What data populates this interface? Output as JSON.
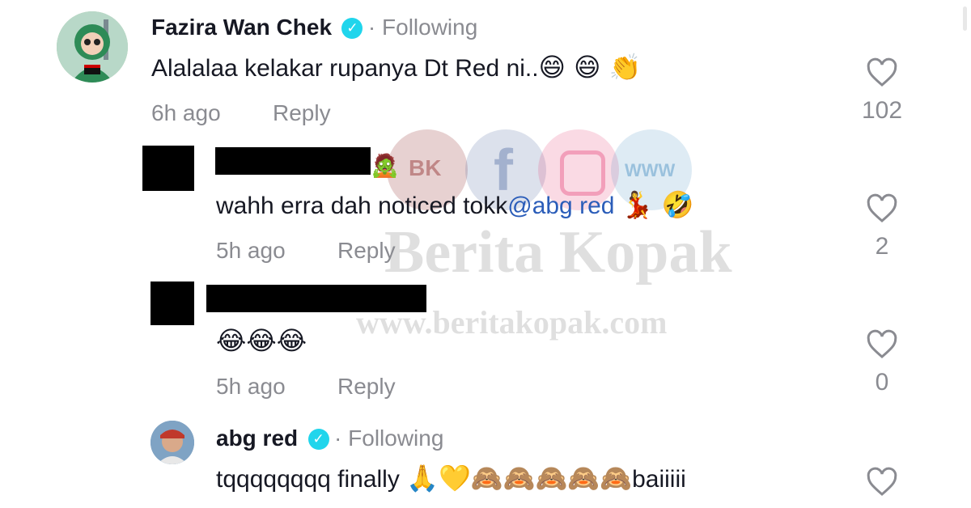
{
  "comments": [
    {
      "author": "Fazira Wan Chek",
      "verified_icon": "verified-check-icon",
      "following": "· Following",
      "text": "Alalalaa kelakar rupanya Dt Red ni..",
      "emojis": "😄 😄 👏",
      "time": "6h ago",
      "reply": "Reply",
      "likes": "102"
    },
    {
      "author": "",
      "author_emoji": "🧟",
      "text_before": "wahh erra dah noticed tokk",
      "mention": "@abg red",
      "emojis": "💃 🤣",
      "time": "5h ago",
      "reply": "Reply",
      "likes": "2"
    },
    {
      "author": "",
      "emojis": "😂😂😂",
      "time": "5h ago",
      "reply": "Reply",
      "likes": "0"
    },
    {
      "author": "abg red",
      "verified_icon": "verified-check-icon",
      "following": "· Following",
      "text": "tqqqqqqqq finally ",
      "emojis": "🙏💛🙈🙈🙈🙈🙈",
      "text_after": "baiiiii"
    }
  ],
  "watermark": {
    "brand": "Berita Kopak",
    "url": "www.beritakopak.com",
    "logo_text": "BK",
    "icons": [
      "bk-logo-icon",
      "facebook-icon",
      "instagram-icon",
      "globe-icon"
    ],
    "colors": [
      "#7a0000",
      "#3b5998",
      "#e1306c",
      "#4a90c2"
    ]
  },
  "colors": {
    "text": "#161823",
    "secondary": "#8a8b91",
    "mention": "#2b5db9",
    "verified": "#20d5ec"
  }
}
